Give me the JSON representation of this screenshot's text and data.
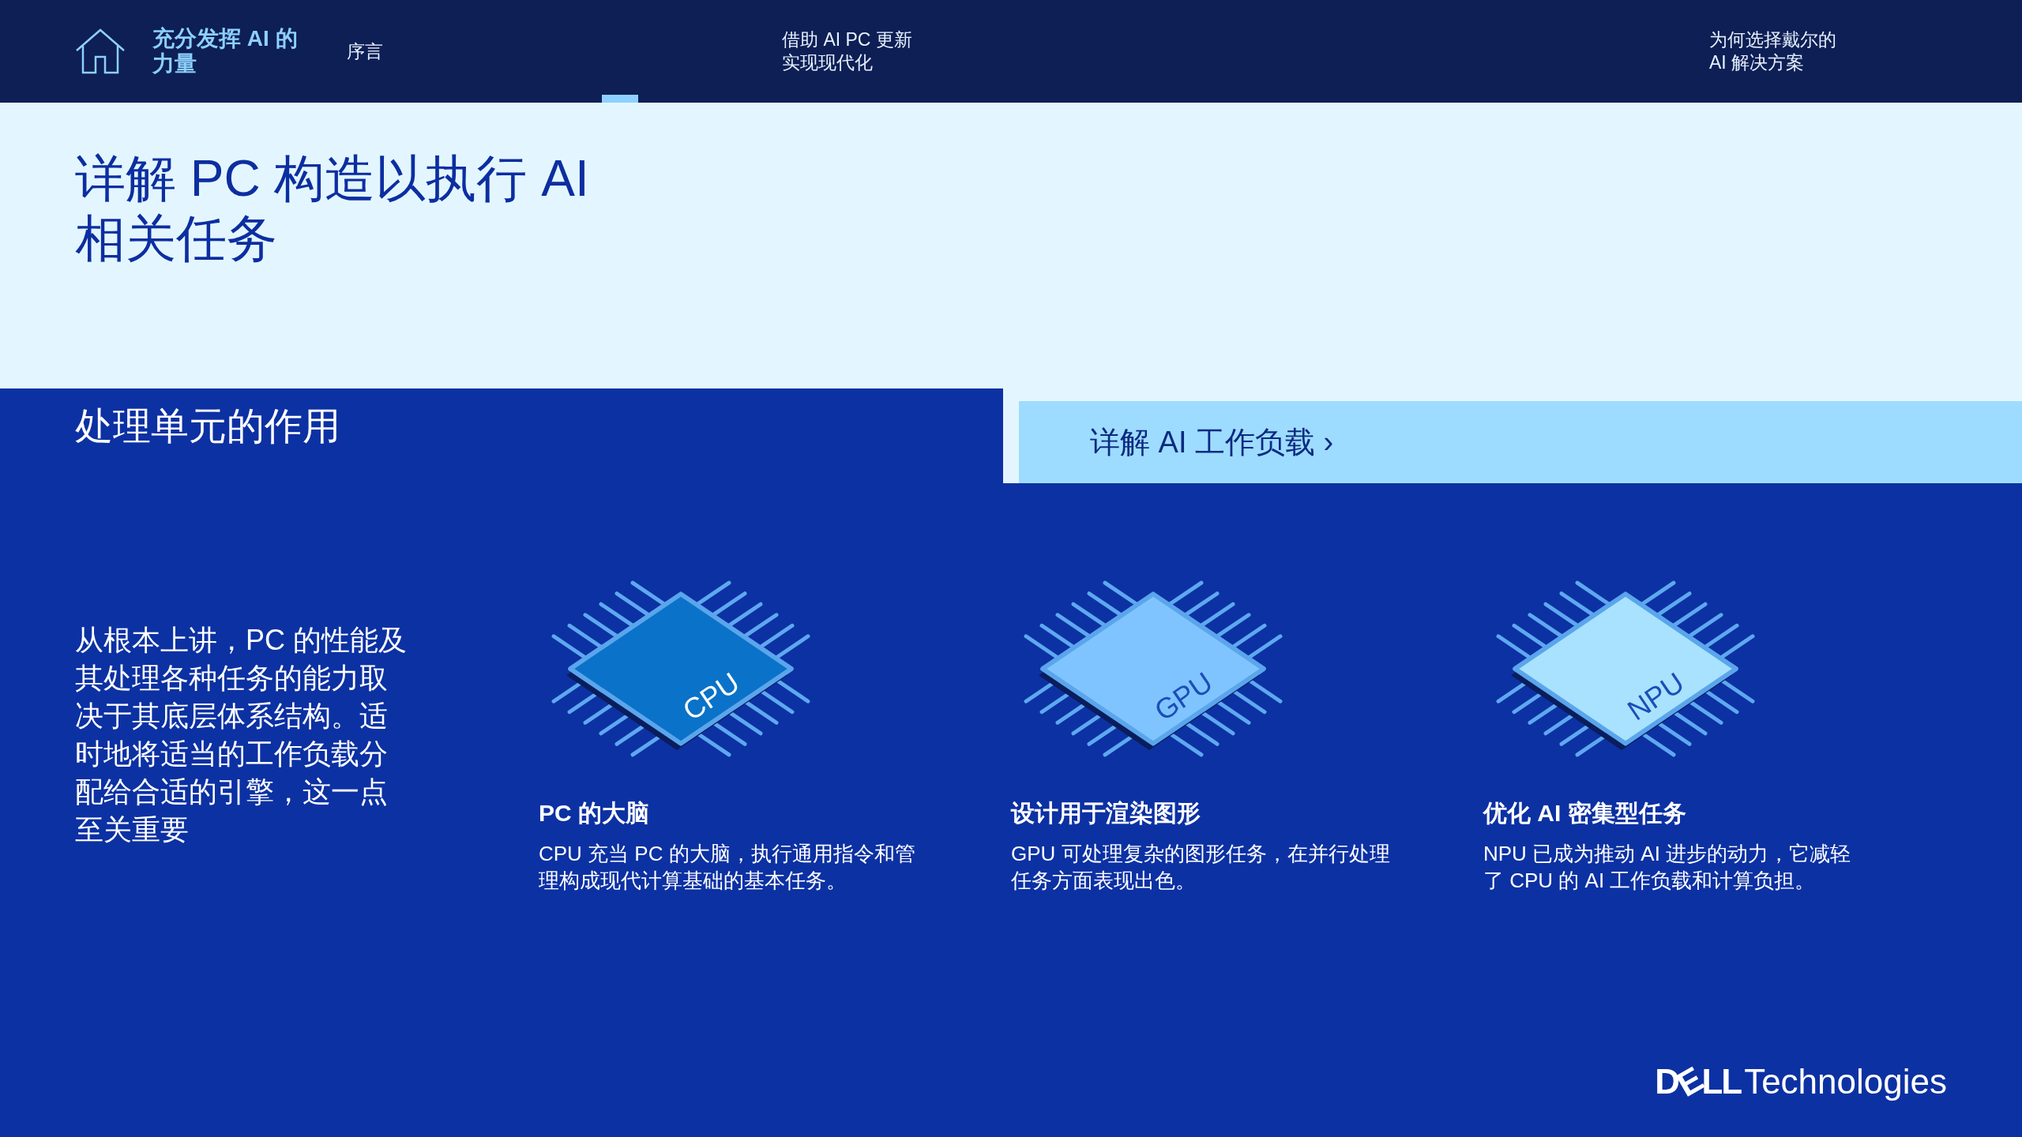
{
  "nav": {
    "title": [
      "充分发挥 AI 的",
      "力量"
    ],
    "items": [
      {
        "label": [
          "序言"
        ],
        "selected": false
      },
      {
        "label": [
          "借助 AI PC 更新",
          "实现现代化"
        ],
        "selected": false
      },
      {
        "label": [
          "为何选择戴尔的",
          "AI 解决方案"
        ],
        "selected": false
      }
    ]
  },
  "hero": {
    "title": [
      "详解 PC 构造以执行 AI",
      "相关任务"
    ]
  },
  "section": {
    "heading": "处理单元的作用",
    "link": "详解 AI 工作负载 ›",
    "intro": "从根本上讲，PC 的性能及其处理各种任务的能力取决于其底层体系结构。适时地将适当的工作负载分配给合适的引擎，这一点至关重要"
  },
  "units": [
    {
      "chip": "CPU",
      "color": "#0a72c8",
      "title": "PC 的大脑",
      "text": "CPU 充当 PC 的大脑，执行通用指令和管理构成现代计算基础的基本任务。"
    },
    {
      "chip": "GPU",
      "color": "#80c4ff",
      "title": "设计用于渲染图形",
      "text": "GPU 可处理复杂的图形任务，在并行处理任务方面表现出色。"
    },
    {
      "chip": "NPU",
      "color": "#a8e2ff",
      "title": "优化 AI 密集型任务",
      "text": "NPU 已成为推动 AI 进步的动力，它减轻了 CPU 的 AI 工作负载和计算负担。"
    }
  ],
  "logo": {
    "brand": "DELL",
    "suffix": "Technologies"
  }
}
